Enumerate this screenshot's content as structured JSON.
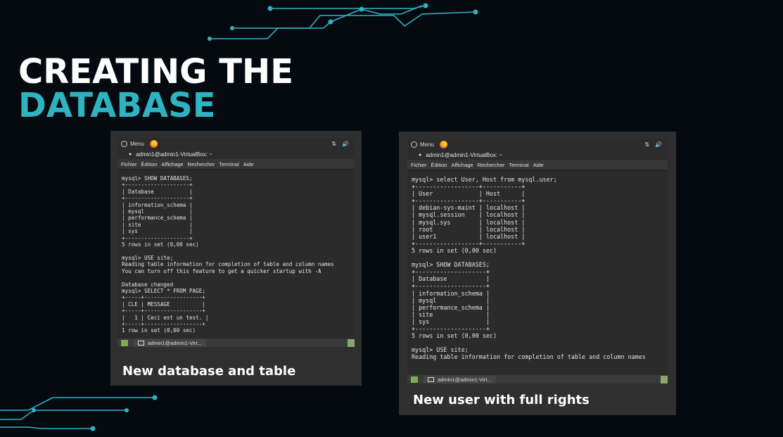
{
  "slide": {
    "title_line1": "CREATING THE",
    "title_line2": "DATABASE",
    "accent_color": "#2fb3c1"
  },
  "panel_left": {
    "topbar_menu": "Menu",
    "tray_network": "⇅",
    "tray_volume": "🔊",
    "window_title": "admin1@admin1-VirtualBox: ~",
    "menus": [
      "Fichier",
      "Édition",
      "Affichage",
      "Rechercher",
      "Terminal",
      "Aide"
    ],
    "terminal_text": "mysql> SHOW DATABASES;\n+--------------------+\n| Database           |\n+--------------------+\n| information_schema |\n| mysql              |\n| performance_schema |\n| site               |\n| sys                |\n+--------------------+\n5 rows in set (0,00 sec)\n\nmysql> USE site;\nReading table information for completion of table and column names\nYou can turn off this feature to get a quicker startup with -A\n\nDatabase changed\nmysql> SELECT * FROM PAGE;\n+-----+------------------+\n| CLE | MESSAGE          |\n+-----+------------------+\n|   1 | Ceci est un test. |\n+-----+------------------+\n1 row in set (0,00 sec)\n\nmysql> █",
    "taskbar_item": "admin1@admin1-Virt...",
    "caption": "New database and table"
  },
  "panel_right": {
    "topbar_menu": "Menu",
    "tray_network": "⇅",
    "tray_volume": "🔊",
    "window_title": "admin1@admin1-VirtualBox: ~",
    "menus": [
      "Fichier",
      "Édition",
      "Affichage",
      "Rechercher",
      "Terminal",
      "Aide"
    ],
    "terminal_text": "mysql> select User, Host from mysql.user;\n+------------------+-----------+\n| User             | Host      |\n+------------------+-----------+\n| debian-sys-maint | localhost |\n| mysql.session    | localhost |\n| mysql.sys        | localhost |\n| root             | localhost |\n| user1            | localhost |\n+------------------+-----------+\n5 rows in set (0,00 sec)\n\nmysql> SHOW DATABASES;\n+--------------------+\n| Database           |\n+--------------------+\n| information_schema |\n| mysql              |\n| performance_schema |\n| site               |\n| sys                |\n+--------------------+\n5 rows in set (0,00 sec)\n\nmysql> USE site;\nReading table information for completion of table and column names",
    "taskbar_item": "admin1@admin1-Virt...",
    "caption": "New user with full rights"
  }
}
